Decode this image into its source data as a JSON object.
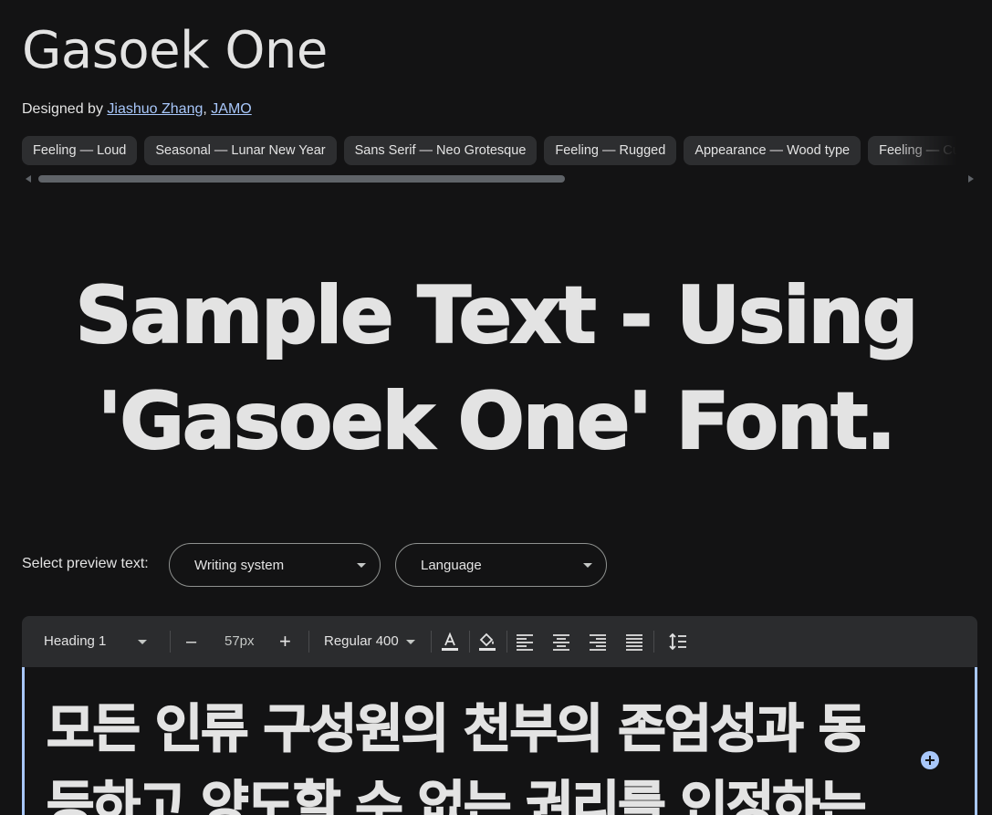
{
  "header": {
    "title": "Gasoek One",
    "designed_by_prefix": "Designed by",
    "designers": [
      "Jiashuo Zhang",
      "JAMO"
    ],
    "designer_separator": ","
  },
  "tags": [
    "Feeling — Loud",
    "Seasonal — Lunar New Year",
    "Sans Serif — Neo Grotesque",
    "Feeling — Rugged",
    "Appearance — Wood type",
    "Feeling — Cu"
  ],
  "sample_text": {
    "line1": "Sample Text - Using",
    "line2": "'Gasoek One' Font."
  },
  "preview": {
    "label": "Select preview text:",
    "writing_system": "Writing system",
    "language": "Language"
  },
  "toolbar": {
    "style": "Heading 1",
    "size": "57px",
    "weight": "Regular 400",
    "decrease_label": "–",
    "increase_label": "+"
  },
  "editor": {
    "line1": "모든 인류 구성원의 천부의 존엄성과 동",
    "line2": "등하고 양도할 수 없는 권리를 인정하는"
  },
  "colors": {
    "background": "#131314",
    "chip": "#2d2e30",
    "link": "#a8c7fa",
    "accent": "#a8c7fa"
  },
  "icons": {
    "text_color": "text-color-icon",
    "highlight": "highlight-icon",
    "align_left": "align-left-icon",
    "align_center": "align-center-icon",
    "align_right": "align-right-icon",
    "align_justify": "align-justify-icon",
    "line_height": "line-height-icon",
    "add": "add-circle-icon"
  }
}
